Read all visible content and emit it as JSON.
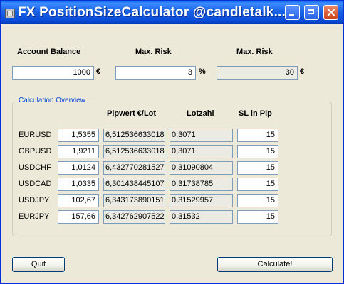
{
  "window": {
    "title": "FX PositionSizeCalculator @candletalk..."
  },
  "top": {
    "account_balance_label": "Account Balance",
    "max_risk_label": "Max. Risk",
    "max_risk_amount_label": "Max. Risk",
    "account_balance_value": "1000",
    "account_balance_unit": "€",
    "max_risk_pct_value": "3",
    "max_risk_pct_unit": "%",
    "max_risk_amount_value": "30",
    "max_risk_amount_unit": "€"
  },
  "overview": {
    "title": "Calculation Overview",
    "headers": {
      "pipwert": "Pipwert €/Lot",
      "lotzahl": "Lotzahl",
      "sl": "SL in Pip"
    },
    "rows": [
      {
        "pair": "EURUSD",
        "price": "1,5355",
        "pipwert": "6,512536633018",
        "lotzahl": "0,3071",
        "sl": "15"
      },
      {
        "pair": "GBPUSD",
        "price": "1,9211",
        "pipwert": "6,512536633018",
        "lotzahl": "0,3071",
        "sl": "15"
      },
      {
        "pair": "USDCHF",
        "price": "1,0124",
        "pipwert": "6,432770281527",
        "lotzahl": "0,31090804",
        "sl": "15"
      },
      {
        "pair": "USDCAD",
        "price": "1,0335",
        "pipwert": "6,301438445107",
        "lotzahl": "0,31738785",
        "sl": "15"
      },
      {
        "pair": "USDJPY",
        "price": "102,67",
        "pipwert": "6,343173890151",
        "lotzahl": "0,31529957",
        "sl": "15"
      },
      {
        "pair": "EURJPY",
        "price": "157,66",
        "pipwert": "6,342762907522",
        "lotzahl": "0,31532",
        "sl": "15"
      }
    ]
  },
  "buttons": {
    "quit": "Quit",
    "calculate": "Calculate!"
  }
}
